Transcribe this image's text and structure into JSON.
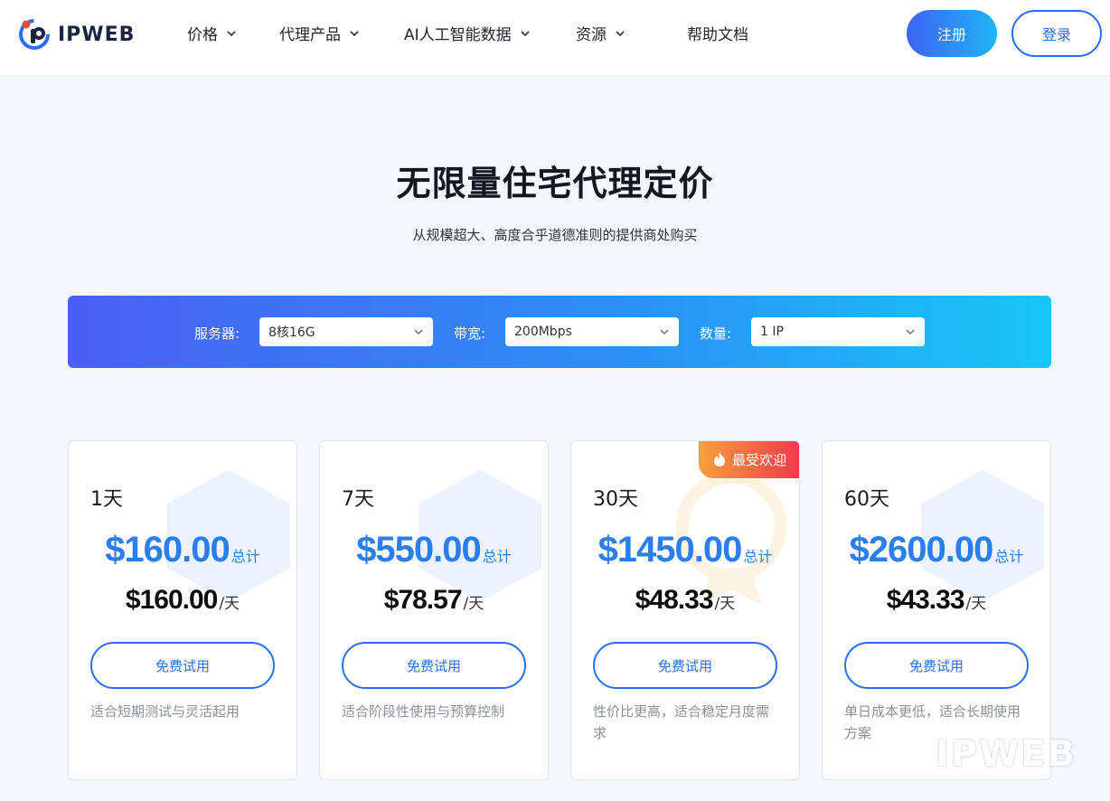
{
  "header": {
    "logo_text": "IPWEB",
    "nav": [
      {
        "label": "价格",
        "has_dropdown": true
      },
      {
        "label": "代理产品",
        "has_dropdown": true
      },
      {
        "label": "AI人工智能数据",
        "has_dropdown": true
      },
      {
        "label": "资源",
        "has_dropdown": true
      },
      {
        "label": "帮助文档",
        "has_dropdown": false
      }
    ],
    "register_label": "注册",
    "login_label": "登录"
  },
  "hero": {
    "title": "无限量住宅代理定价",
    "subtitle": "从规模超大、高度合乎道德准则的提供商处购买"
  },
  "filters": {
    "server": {
      "label": "服务器:",
      "value": "8核16G"
    },
    "bandwidth": {
      "label": "带宽:",
      "value": "200Mbps"
    },
    "quantity": {
      "label": "数量:",
      "value": "1 IP"
    }
  },
  "plans": [
    {
      "duration": "1天",
      "total_price": "$160.00",
      "total_unit": "总计",
      "day_price": "$160.00",
      "day_unit": "/天",
      "button": "免费试用",
      "desc": "适合短期测试与灵活起用"
    },
    {
      "duration": "7天",
      "total_price": "$550.00",
      "total_unit": "总计",
      "day_price": "$78.57",
      "day_unit": "/天",
      "button": "免费试用",
      "desc": "适合阶段性使用与预算控制"
    },
    {
      "duration": "30天",
      "total_price": "$1450.00",
      "total_unit": "总计",
      "day_price": "$48.33",
      "day_unit": "/天",
      "button": "免费试用",
      "desc": "性价比更高，适合稳定月度需求",
      "badge": "最受欢迎"
    },
    {
      "duration": "60天",
      "total_price": "$2600.00",
      "total_unit": "总计",
      "day_price": "$43.33",
      "day_unit": "/天",
      "button": "免费试用",
      "desc": "单日成本更低，适合长期使用方案"
    }
  ],
  "watermark": {
    "text": "IPWEB"
  },
  "colors": {
    "accent": "#2a6df4",
    "price_blue": "#2a7ef0",
    "badge_from": "#f8a03b",
    "badge_to": "#f3394d"
  }
}
